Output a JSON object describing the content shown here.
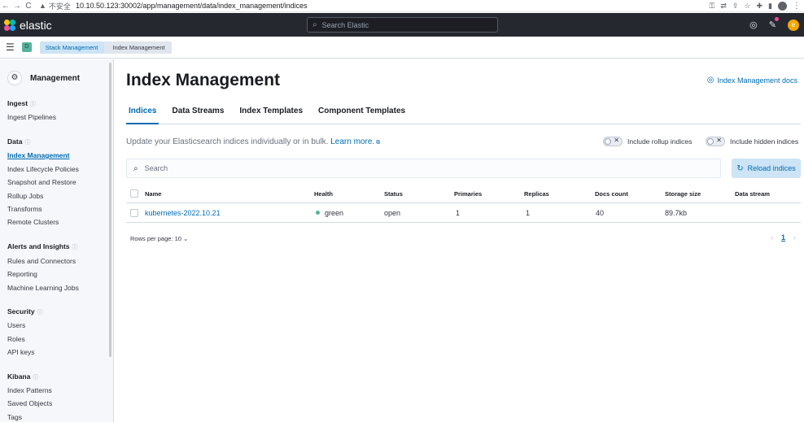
{
  "browser": {
    "back": "←",
    "forward": "→",
    "reload": "C",
    "warn_icon": "▲",
    "insecure_label": "不安全",
    "url": "10.10.50.123:30002/app/management/data/index_management/indices",
    "icons": [
      "key-icon",
      "translate-icon",
      "share-icon",
      "star-icon",
      "extensions-icon",
      "sidebar-icon",
      "profile-icon",
      "menu-icon"
    ]
  },
  "header": {
    "brand": "elastic",
    "search_placeholder": "Search Elastic",
    "user_initial": "e"
  },
  "breadcrumb": {
    "space_initial": "D",
    "items": [
      "Stack Management",
      "Index Management"
    ]
  },
  "sidebar": {
    "title": "Management",
    "groups": [
      {
        "label": "Ingest",
        "items": [
          "Ingest Pipelines"
        ]
      },
      {
        "label": "Data",
        "items": [
          "Index Management",
          "Index Lifecycle Policies",
          "Snapshot and Restore",
          "Rollup Jobs",
          "Transforms",
          "Remote Clusters"
        ]
      },
      {
        "label": "Alerts and Insights",
        "items": [
          "Rules and Connectors",
          "Reporting",
          "Machine Learning Jobs"
        ]
      },
      {
        "label": "Security",
        "items": [
          "Users",
          "Roles",
          "API keys"
        ]
      },
      {
        "label": "Kibana",
        "items": [
          "Index Patterns",
          "Saved Objects",
          "Tags"
        ]
      }
    ],
    "active_item": "Index Management"
  },
  "main": {
    "title": "Index Management",
    "docs_link": "Index Management docs",
    "tabs": [
      "Indices",
      "Data Streams",
      "Index Templates",
      "Component Templates"
    ],
    "active_tab": "Indices",
    "description": "Update your Elasticsearch indices individually or in bulk.",
    "learn_more": "Learn more.",
    "toggle_rollup": "Include rollup indices",
    "toggle_hidden": "Include hidden indices",
    "search_placeholder": "Search",
    "reload_label": "Reload indices",
    "columns": [
      "Name",
      "Health",
      "Status",
      "Primaries",
      "Replicas",
      "Docs count",
      "Storage size",
      "Data stream"
    ],
    "rows": [
      {
        "name": "kubernetes-2022.10.21",
        "health": "green",
        "status": "open",
        "primaries": "1",
        "replicas": "1",
        "docs_count": "40",
        "storage_size": "89.7kb",
        "data_stream": ""
      }
    ],
    "rows_per_page": "Rows per page: 10",
    "current_page": "1",
    "health_color": "#54b399",
    "accent_color": "#006bb4"
  }
}
